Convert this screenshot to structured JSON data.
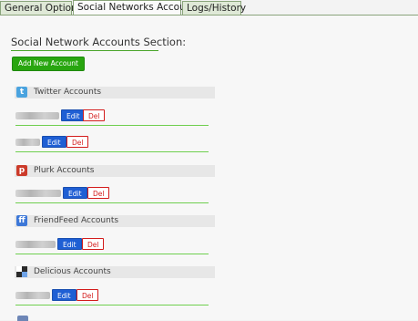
{
  "tabs": [
    {
      "label": "General Options",
      "active": false
    },
    {
      "label": "Social Networks Accounts",
      "active": true
    },
    {
      "label": "Logs/History",
      "active": false
    }
  ],
  "section_title": "Social Network Accounts Section:",
  "add_button_label": "Add New Account",
  "groups": [
    {
      "title": "Twitter Accounts",
      "icon": "twitter-icon"
    },
    {
      "title": "Plurk Accounts",
      "icon": "plurk-icon"
    },
    {
      "title": "FriendFeed Accounts",
      "icon": "friendfeed-icon"
    },
    {
      "title": "Delicious Accounts",
      "icon": "delicious-icon"
    }
  ],
  "edit_label": "Edit",
  "del_label": "Del",
  "colors": {
    "tab_bg": "#dfe9d7",
    "add_button": "#28a60f",
    "edit_button": "#1f5fd4",
    "del_border": "#d31c1c",
    "separator": "#6fcf4f",
    "twitter": "#4aa3df",
    "plurk": "#cc3b2a",
    "friendfeed": "#3d78d8"
  }
}
